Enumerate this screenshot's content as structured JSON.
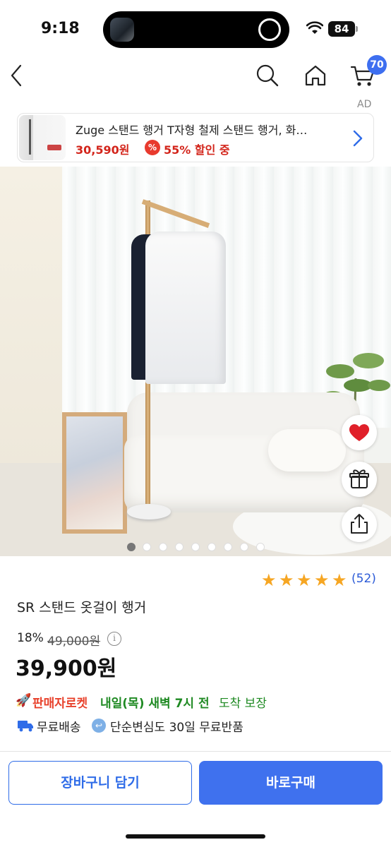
{
  "status_bar": {
    "time": "9:18",
    "battery": "84"
  },
  "nav": {
    "cart_count": "70"
  },
  "ad": {
    "label": "AD",
    "title": "Zuge 스탠드 행거 T자형 철제 스탠드 행거, 화…",
    "price": "30,590원",
    "discount_icon": "%",
    "discount_text": "55% 할인 중"
  },
  "gallery": {
    "image_count": 9,
    "active_index": 0
  },
  "rating": {
    "stars": 5,
    "review_count": "(52)"
  },
  "product": {
    "name": "SR 스탠드 옷걸이 행거",
    "discount_pct": "18%",
    "original_price": "49,000원",
    "info_icon": "i",
    "price": "39,900원"
  },
  "delivery": {
    "rocket_icon": "🚀",
    "rocket_brand": "판매자로켓",
    "arrival_bold": "내일(목) 새벽 7시 전",
    "arrival_text": "도착 보장",
    "free_shipping": "무료배송",
    "return_icon": "↩",
    "return_policy": "단순변심도 30일 무료반품"
  },
  "actions": {
    "add_to_cart": "장바구니 담기",
    "buy_now": "바로구매"
  },
  "colors": {
    "accent": "#3f71ee",
    "price_red": "#d3251b",
    "rocket_green": "#1f8a23",
    "star": "#f6a623",
    "heart": "#e0202a"
  },
  "icons": [
    "back-chevron-icon",
    "search-icon",
    "home-icon",
    "cart-icon",
    "chevron-right-icon",
    "heart-icon",
    "gift-icon",
    "share-icon",
    "info-icon",
    "rocket-icon",
    "truck-icon",
    "return-icon",
    "star-icon",
    "wifi-icon",
    "battery-icon"
  ]
}
